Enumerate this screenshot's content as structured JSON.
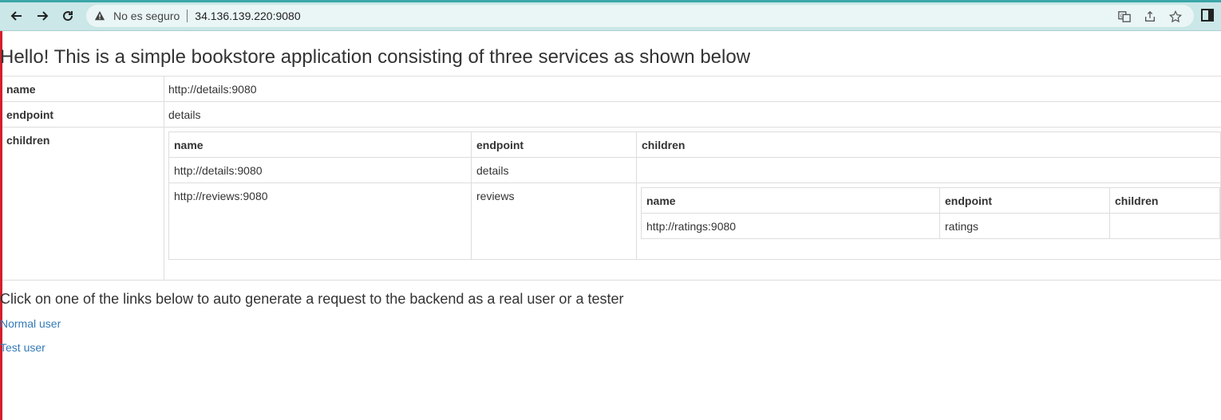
{
  "browser": {
    "not_secure_label": "No es seguro",
    "url": "34.136.139.220:9080",
    "icons": [
      "back-icon",
      "forward-icon",
      "reload-icon",
      "warning-icon",
      "translate-icon",
      "share-icon",
      "star-icon",
      "side-panel-icon"
    ]
  },
  "page": {
    "title": "Hello! This is a simple bookstore application consisting of three services as shown below",
    "table": {
      "name_label": "name",
      "name_value": "http://details:9080",
      "endpoint_label": "endpoint",
      "endpoint_value": "details",
      "children_label": "children",
      "children": {
        "headers": [
          "name",
          "endpoint",
          "children"
        ],
        "rows": [
          {
            "name": "http://details:9080",
            "endpoint": "details"
          },
          {
            "name": "http://reviews:9080",
            "endpoint": "reviews"
          }
        ],
        "reviews_children": {
          "headers": [
            "name",
            "endpoint",
            "children"
          ],
          "rows": [
            {
              "name": "http://ratings:9080",
              "endpoint": "ratings"
            }
          ]
        }
      }
    },
    "intro": "Click on one of the links below to auto generate a request to the backend as a real user or a tester",
    "links": {
      "normal_user": "Normal user",
      "test_user": "Test user"
    }
  }
}
